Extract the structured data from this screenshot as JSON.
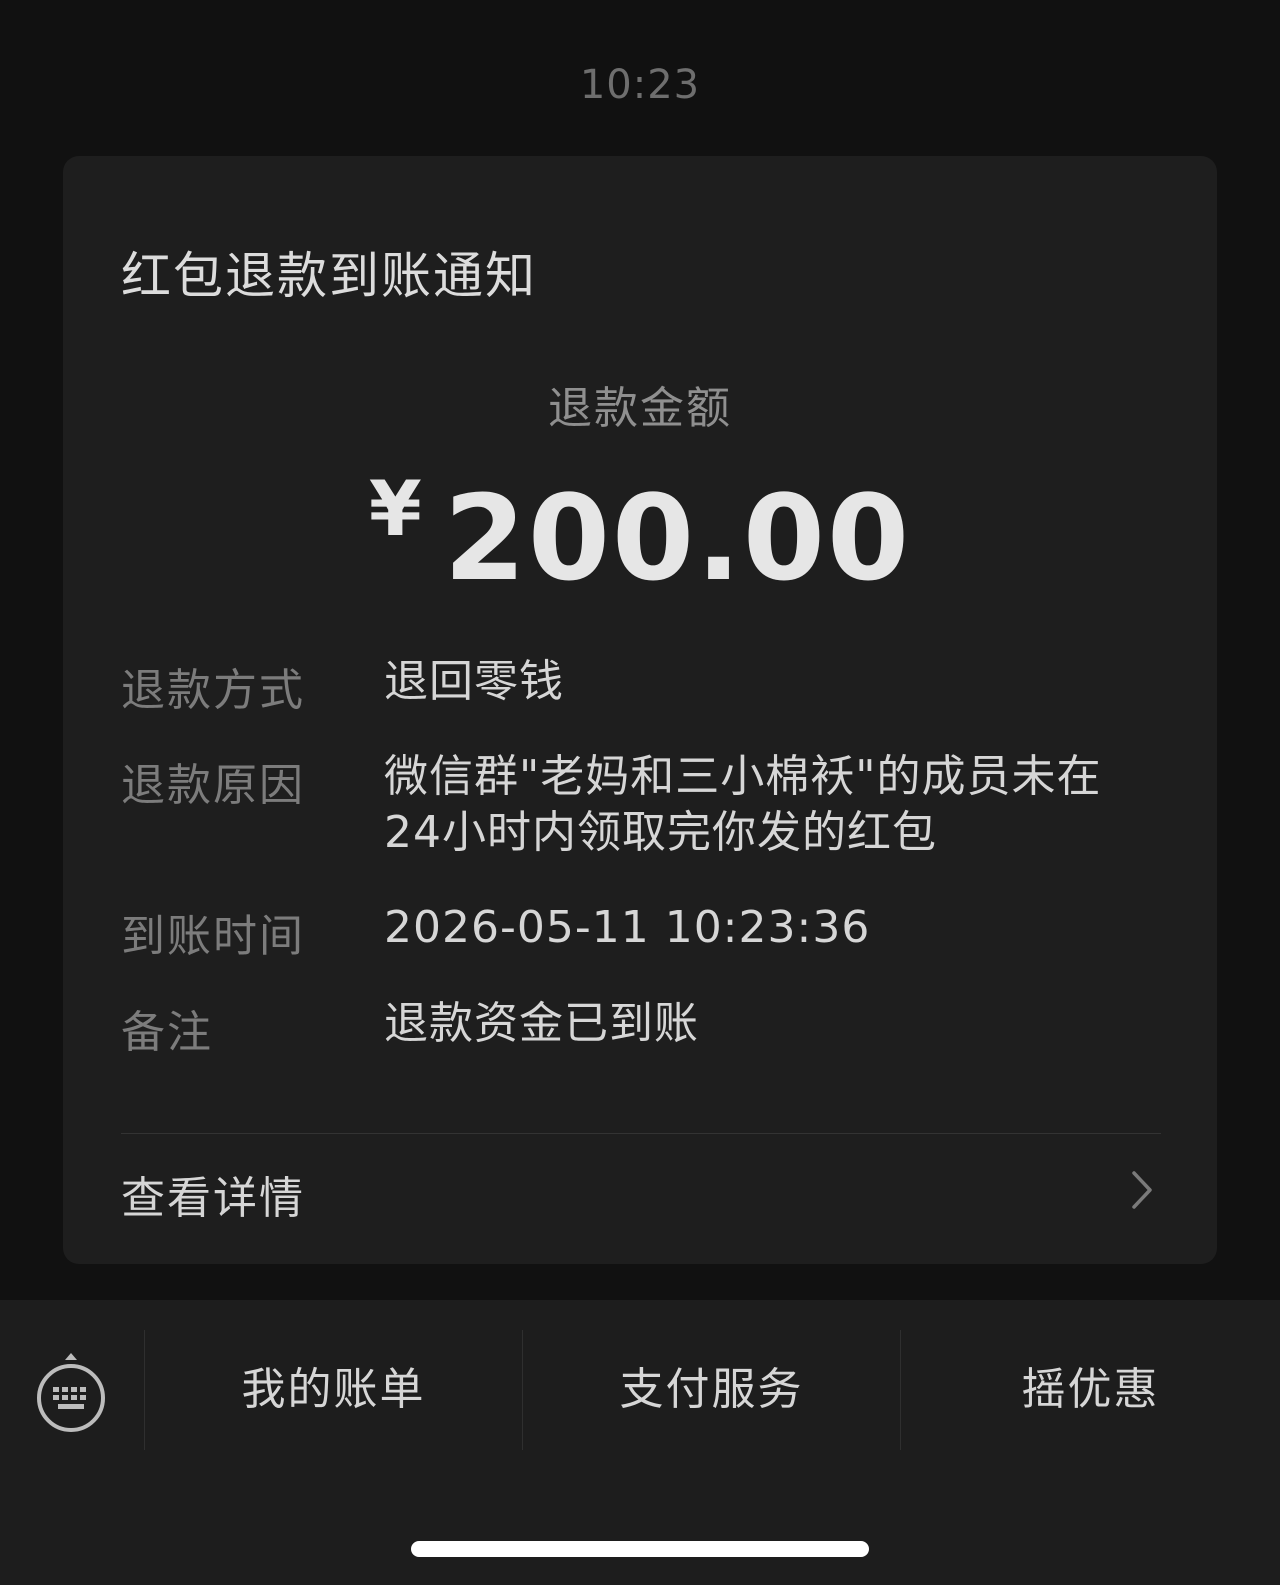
{
  "chat": {
    "timestamp": "10:23"
  },
  "notification": {
    "title": "红包退款到账通知",
    "amount_label": "退款金额",
    "currency_symbol": "¥",
    "amount": "200.00",
    "rows": [
      {
        "label": "退款方式",
        "value": "退回零钱"
      },
      {
        "label": "退款原因",
        "value": "微信群\"老妈和三小棉袄\"的成员未在 24小时内领取完你发的红包"
      },
      {
        "label": "到账时间",
        "value": "2026-05-11 10:23:36"
      },
      {
        "label": "备注",
        "value": "退款资金已到账"
      }
    ],
    "details_link": "查看详情"
  },
  "bottom_menu": {
    "keyboard_icon": "keyboard-toggle-icon",
    "items": [
      {
        "label": "我的账单"
      },
      {
        "label": "支付服务"
      },
      {
        "label": "摇优惠"
      }
    ]
  }
}
